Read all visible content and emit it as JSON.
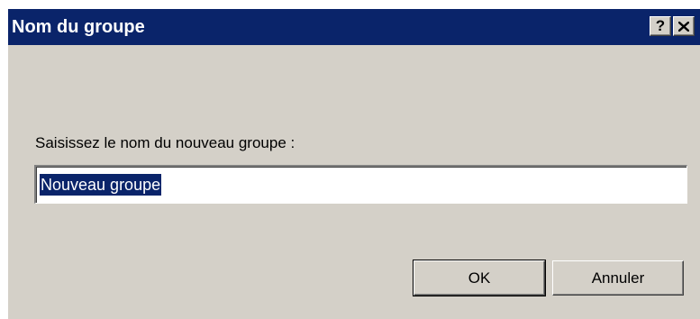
{
  "window": {
    "title": "Nom du groupe",
    "help_glyph": "?",
    "close_icon": "close-icon",
    "titlebar_color": "#0a246a",
    "face_color": "#d4d0c8"
  },
  "form": {
    "prompt": "Saisissez le nom du nouveau groupe :",
    "group_name_value": "Nouveau groupe"
  },
  "buttons": {
    "ok_label": "OK",
    "cancel_label": "Annuler"
  }
}
